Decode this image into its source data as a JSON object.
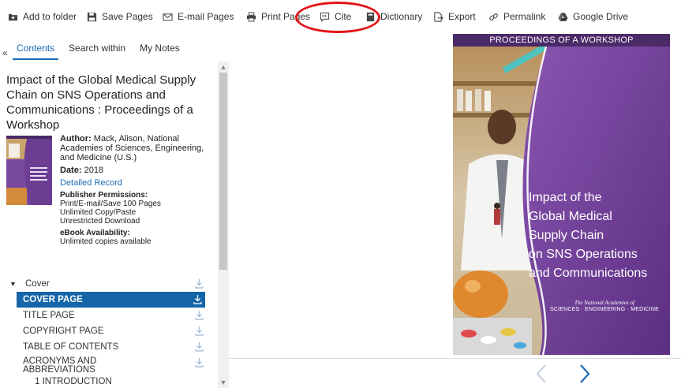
{
  "toolbar": {
    "items": [
      {
        "label": "Add to folder",
        "icon": "folder-add-icon"
      },
      {
        "label": "Save Pages",
        "icon": "save-icon"
      },
      {
        "label": "E-mail Pages",
        "icon": "envelope-icon"
      },
      {
        "label": "Print Pages",
        "icon": "printer-icon"
      },
      {
        "label": "Cite",
        "icon": "quote-icon"
      },
      {
        "label": "Dictionary",
        "icon": "book-icon"
      },
      {
        "label": "Export",
        "icon": "export-icon"
      },
      {
        "label": "Permalink",
        "icon": "link-icon"
      },
      {
        "label": "Google Drive",
        "icon": "google-drive-icon"
      }
    ],
    "highlight_color": "#e3151a"
  },
  "panel": {
    "collapse_label": "«",
    "tabs": [
      {
        "label": "Contents"
      },
      {
        "label": "Search within"
      },
      {
        "label": "My Notes"
      }
    ]
  },
  "book": {
    "title": "Impact of the Global Medical Supply Chain on SNS Operations and Communications : Proceedings of a Workshop",
    "author_label": "Author:",
    "author": "Mack, Alison, National Academies of Sciences, Engineering, and Medicine (U.S.)",
    "date_label": "Date:",
    "date": "2018",
    "detailed_record": "Detailed Record",
    "permissions_label": "Publisher Permissions:",
    "permissions": [
      "Print/E-mail/Save 100 Pages",
      "Unlimited Copy/Paste",
      "Unrestricted Download"
    ],
    "availability_label": "eBook Availability:",
    "availability": "Unlimited copies available"
  },
  "toc": {
    "header": "Cover",
    "items": [
      {
        "label": "COVER PAGE"
      },
      {
        "label": "TITLE PAGE"
      },
      {
        "label": "COPYRIGHT PAGE"
      },
      {
        "label": "TABLE OF CONTENTS"
      },
      {
        "label": "ACRONYMS AND ABBREVIATIONS"
      },
      {
        "label": "1 INTRODUCTION"
      }
    ]
  },
  "cover": {
    "header": "PROCEEDINGS OF A WORKSHOP",
    "title_lines": [
      "Impact of the",
      "Global Medical",
      "Supply Chain",
      "on SNS Operations",
      "and Communications"
    ],
    "publisher_line1": "The National Academies of",
    "publisher_line2": "SCIENCES · ENGINEERING · MEDICINE"
  },
  "colors": {
    "accent": "#1a6bb5",
    "toc_active_bg": "#1565a8",
    "cover_purple": "#4b2a68",
    "nav_active": "#1a6bb5",
    "nav_disabled": "#c9d4e4"
  }
}
